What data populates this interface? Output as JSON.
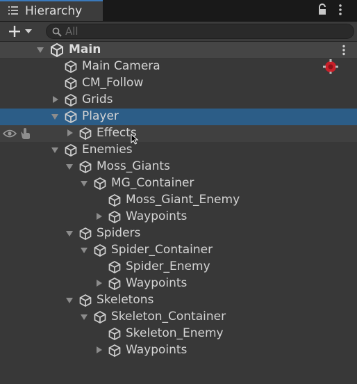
{
  "tab": {
    "title": "Hierarchy",
    "icon": "list-icon"
  },
  "toolbar": {
    "create_symbol": "+",
    "search_placeholder": "All"
  },
  "scene": {
    "name": "Main",
    "icon": "unity-logo-icon"
  },
  "colors": {
    "selection": "#2c5d87",
    "panel": "#383838",
    "tab_accent": "#3a79bb",
    "camera_badge": "#c8202a"
  },
  "tree": [
    {
      "label": "Main Camera",
      "depth": 0,
      "expander": "none",
      "selected": false,
      "badge": "cinemachine-camera-icon"
    },
    {
      "label": "CM_Follow",
      "depth": 0,
      "expander": "none",
      "selected": false
    },
    {
      "label": "Grids",
      "depth": 0,
      "expander": "collapsed",
      "selected": false
    },
    {
      "label": "Player",
      "depth": 0,
      "expander": "expanded",
      "selected": true
    },
    {
      "label": "Effects",
      "depth": 1,
      "expander": "collapsed",
      "selected": false,
      "hover": true
    },
    {
      "label": "Enemies",
      "depth": 0,
      "expander": "expanded",
      "selected": false
    },
    {
      "label": "Moss_Giants",
      "depth": 1,
      "expander": "expanded",
      "selected": false
    },
    {
      "label": "MG_Container",
      "depth": 2,
      "expander": "expanded",
      "selected": false
    },
    {
      "label": "Moss_Giant_Enemy",
      "depth": 3,
      "expander": "none",
      "selected": false
    },
    {
      "label": "Waypoints",
      "depth": 3,
      "expander": "collapsed",
      "selected": false
    },
    {
      "label": "Spiders",
      "depth": 1,
      "expander": "expanded",
      "selected": false
    },
    {
      "label": "Spider_Container",
      "depth": 2,
      "expander": "expanded",
      "selected": false
    },
    {
      "label": "Spider_Enemy",
      "depth": 3,
      "expander": "none",
      "selected": false
    },
    {
      "label": "Waypoints",
      "depth": 3,
      "expander": "collapsed",
      "selected": false
    },
    {
      "label": "Skeletons",
      "depth": 1,
      "expander": "expanded",
      "selected": false
    },
    {
      "label": "Skeleton_Container",
      "depth": 2,
      "expander": "expanded",
      "selected": false
    },
    {
      "label": "Skeleton_Enemy",
      "depth": 3,
      "expander": "none",
      "selected": false
    },
    {
      "label": "Waypoints",
      "depth": 3,
      "expander": "collapsed",
      "selected": false
    }
  ]
}
